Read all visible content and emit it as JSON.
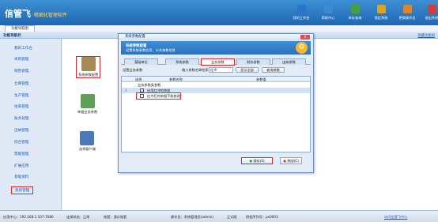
{
  "app": {
    "logo": "信管飞",
    "subtitle": "·精细化管理软件"
  },
  "toolbar": [
    {
      "label": "我的工作台",
      "icon": "monitor-icon",
      "color": "#2a74c9"
    },
    {
      "label": "帮助中心",
      "icon": "help-icon",
      "color": "#3a8ad8"
    },
    {
      "label": "库存查询",
      "icon": "box-icon",
      "color": "#47a040"
    },
    {
      "label": "锁定系统",
      "icon": "lock-icon",
      "color": "#e0a21d"
    },
    {
      "label": "更换操作员",
      "icon": "user-icon",
      "color": "#d8862f"
    },
    {
      "label": "退出系统",
      "icon": "exit-icon",
      "color": "#d33c3c"
    }
  ],
  "subtab": "功能导航图",
  "nav_bar": {
    "title": "功能导航栏",
    "right_link": "隐藏功能树"
  },
  "sidebar": [
    "我的工作台",
    "采购管理",
    "销售管理",
    "仓库管理",
    "生产管理",
    "往来管理",
    "账务处理",
    "出纳管理",
    "综合管理",
    "票据管理",
    "扩展应用",
    "基础资料",
    "系统管理"
  ],
  "sidebar_selected": 12,
  "main_icons": [
    {
      "label": "系统参数配置",
      "icon": "settings-doc-icon",
      "color": "#a88b56",
      "selected": true
    },
    {
      "label": "单据业务参数",
      "icon": "doc-params-icon",
      "color": "#5ea05a",
      "selected": false
    },
    {
      "label": "选择客户端",
      "icon": "client-icon",
      "color": "#4a78b8",
      "selected": false
    }
  ],
  "dialog": {
    "title": "系统参数配置",
    "close": "X",
    "banner_title": "系统参数配置",
    "banner_sub": "设置系统参数信息，公共参数信息",
    "tabs": [
      "基础单位",
      "系统参数",
      "业务参数",
      "财务参数",
      "出纳参数"
    ],
    "selected_tab": 2,
    "search": {
      "label1": "设置业务参数",
      "label2": "输入参数名称检索：",
      "value": "红冲",
      "show_all": "显示全部",
      "query": "查询参数"
    },
    "grid_headers": [
      "选择",
      "参数名称",
      "参数值"
    ],
    "group_label": "业务参数类参数",
    "rows": [
      {
        "name": "启用红冲的审核",
        "checked": true
      },
      {
        "name": "红冲后的单据不能修改",
        "checked": false
      }
    ],
    "save": "保存(S)",
    "close_btn": "关闭(C)"
  },
  "status": {
    "server": "应用中心：192.168.1.107:7080",
    "state": "连接状态：正常",
    "account": "账套：演示账套",
    "operator": "操作员：系统管理员(admin)",
    "edition": "正式版",
    "serial": "授权序列号：ps0003",
    "link": "访问信管飞中心"
  }
}
